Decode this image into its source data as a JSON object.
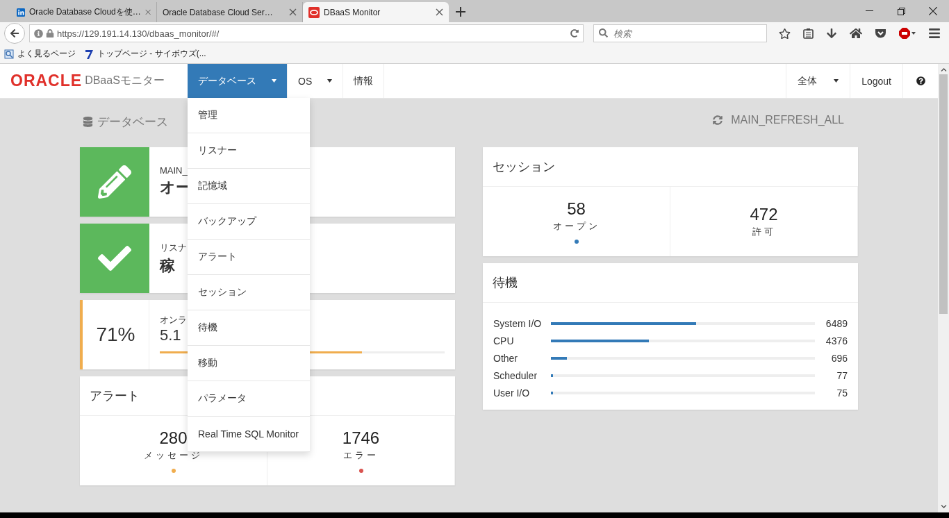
{
  "browser": {
    "tabs": [
      {
        "title": "Oracle Database Cloudを使…",
        "selected": false,
        "kind": "social"
      },
      {
        "title": "Oracle Database Cloud Ser…",
        "selected": false,
        "kind": "plain"
      },
      {
        "title": "DBaaS Monitor",
        "selected": true,
        "kind": "app"
      }
    ],
    "address": "https://129.191.14.130/dbaas_monitor/#/",
    "search": {
      "placeholder": "検索"
    },
    "bookmarks": [
      {
        "label": "よく見るページ",
        "kind": "page"
      },
      {
        "label": "トップページ - サイボウズ(...",
        "kind": "site"
      }
    ]
  },
  "navbar": {
    "logo": "ORACLE",
    "brand": "DBaaSモニター",
    "items": [
      {
        "label": "データベース",
        "selected": true,
        "dropdown": true
      },
      {
        "label": "OS",
        "selected": false,
        "dropdown": true
      },
      {
        "label": "情報",
        "selected": false,
        "dropdown": false
      }
    ],
    "right_items": [
      {
        "label": "全体",
        "dropdown": true
      },
      {
        "label": "Logout",
        "dropdown": false
      }
    ]
  },
  "dropdown_menu": [
    "管理",
    "リスナー",
    "記憶域",
    "バックアップ",
    "アラート",
    "セッション",
    "待機",
    "移動",
    "パラメータ",
    "Real Time SQL Monitor"
  ],
  "page": {
    "title": "データベース",
    "refresh": "MAIN_REFRESH_ALL"
  },
  "status_cards": [
    {
      "kind": "tile",
      "label": "MAIN_",
      "value": "オー"
    },
    {
      "kind": "tile",
      "label": "リスナ",
      "value": "稼"
    },
    {
      "kind": "usage",
      "percent": "71%",
      "label": "オンラ",
      "value": "5.1",
      "level": 0.71
    }
  ],
  "alerts": {
    "title": "アラート",
    "stats": [
      {
        "value": "280",
        "label": "メッセージ",
        "color": "#f0ad4e"
      },
      {
        "value": "1746",
        "label": "エラー",
        "color": "#d9534f"
      }
    ]
  },
  "sessions": {
    "title": "セッション",
    "stats": [
      {
        "value": "58",
        "label": "オープン",
        "color": "#337ab7"
      },
      {
        "value": "472",
        "label": "許可"
      }
    ]
  },
  "waits": {
    "title": "待機",
    "rows": [
      {
        "name": "System I/O",
        "level": 0.55,
        "value": "6489"
      },
      {
        "name": "CPU",
        "level": 0.37,
        "value": "4376"
      },
      {
        "name": "Other",
        "level": 0.06,
        "value": "696"
      },
      {
        "name": "Scheduler",
        "level": 0.007,
        "value": "77"
      },
      {
        "name": "User I/O",
        "level": 0.007,
        "value": "75"
      }
    ]
  }
}
